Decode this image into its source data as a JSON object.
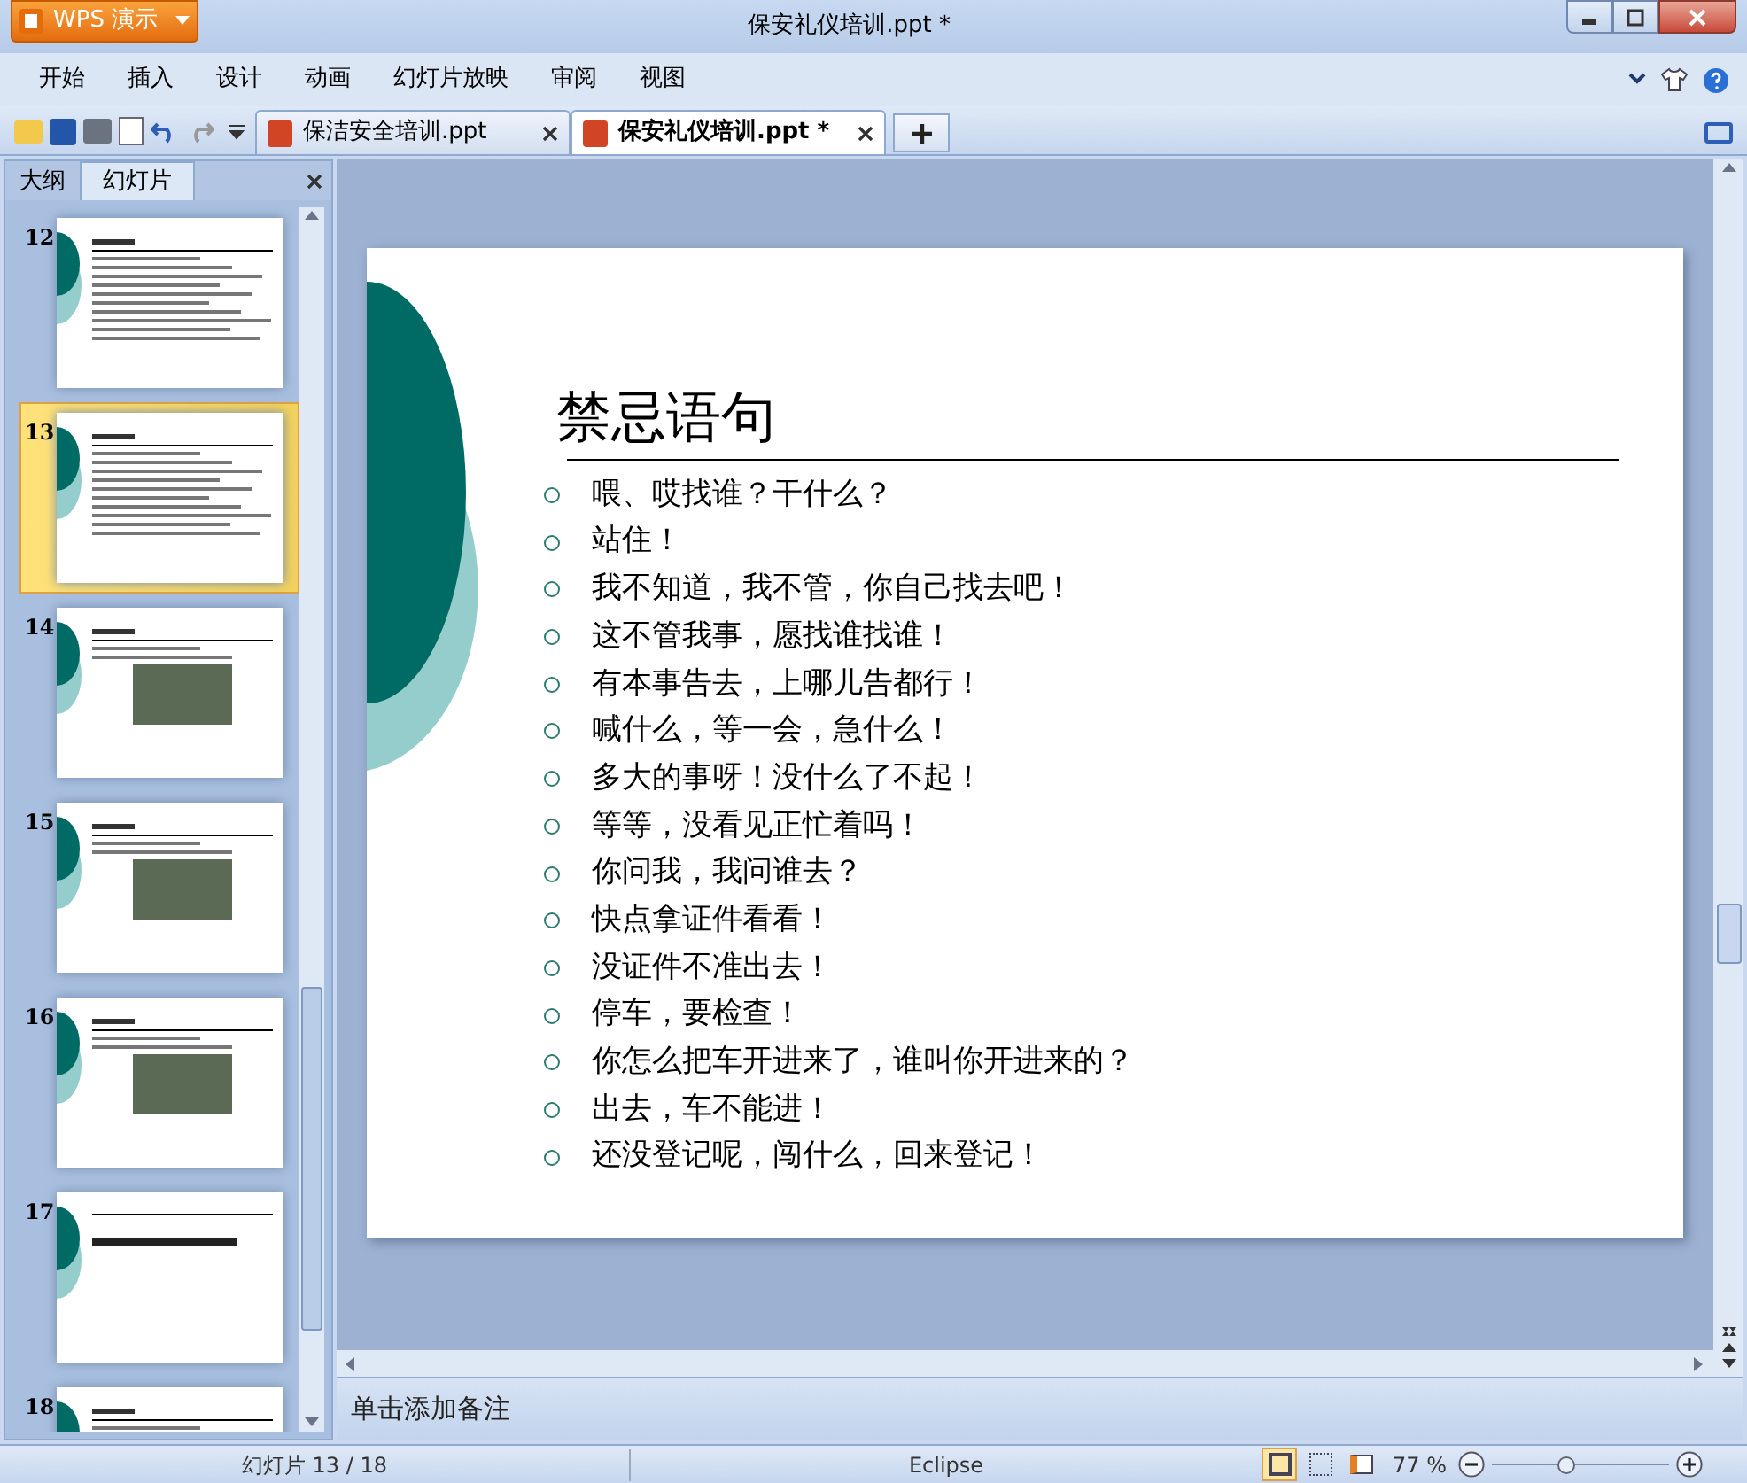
{
  "window": {
    "app_button": "WPS 演示",
    "title": "保安礼仪培训.ppt *"
  },
  "menu": [
    {
      "label": "开始",
      "selected": false
    },
    {
      "label": "插入",
      "selected": false
    },
    {
      "label": "设计",
      "selected": false
    },
    {
      "label": "动画",
      "selected": false
    },
    {
      "label": "幻灯片放映",
      "selected": false
    },
    {
      "label": "审阅",
      "selected": false
    },
    {
      "label": "视图",
      "selected": false
    }
  ],
  "doc_tabs": [
    {
      "label": "保洁安全培训.ppt",
      "selected": false
    },
    {
      "label": "保安礼仪培训.ppt *",
      "selected": true
    }
  ],
  "side_tabs": [
    {
      "label": "大纲",
      "selected": false
    },
    {
      "label": "幻灯片",
      "selected": true
    }
  ],
  "thumbnails": [
    {
      "number": "12",
      "kind": "text",
      "selected": false
    },
    {
      "number": "13",
      "kind": "text",
      "selected": true
    },
    {
      "number": "14",
      "kind": "photo",
      "selected": false
    },
    {
      "number": "15",
      "kind": "photo",
      "selected": false
    },
    {
      "number": "16",
      "kind": "photo",
      "selected": false
    },
    {
      "number": "17",
      "kind": "heading",
      "selected": false
    },
    {
      "number": "18",
      "kind": "text",
      "selected": false
    }
  ],
  "slide": {
    "title": "禁忌语句",
    "bullets": [
      "喂、哎找谁？干什么？",
      "站住！",
      "我不知道，我不管，你自己找去吧！",
      "这不管我事，愿找谁找谁！",
      "有本事告去，上哪儿告都行！",
      "喊什么，等一会，急什么！",
      "多大的事呀！没什么了不起！",
      "等等，没看见正忙着吗！",
      "你问我，我问谁去？",
      "快点拿证件看看！",
      "没证件不准出去！",
      "停车，要检查！",
      "你怎么把车开进来了，谁叫你开进来的？",
      "出去，车不能进！",
      "还没登记呢，闯什么，回来登记！"
    ]
  },
  "notes": {
    "placeholder": "单击添加备注"
  },
  "status_bar": {
    "slide_counter": "幻灯片 13 / 18",
    "theme": "Eclipse",
    "views": [
      {
        "kind": "normal",
        "selected": true
      },
      {
        "kind": "sorter",
        "selected": false
      },
      {
        "kind": "show",
        "selected": false
      }
    ],
    "zoom": "77 %",
    "zoom_slider": {
      "level": 0.42
    }
  }
}
